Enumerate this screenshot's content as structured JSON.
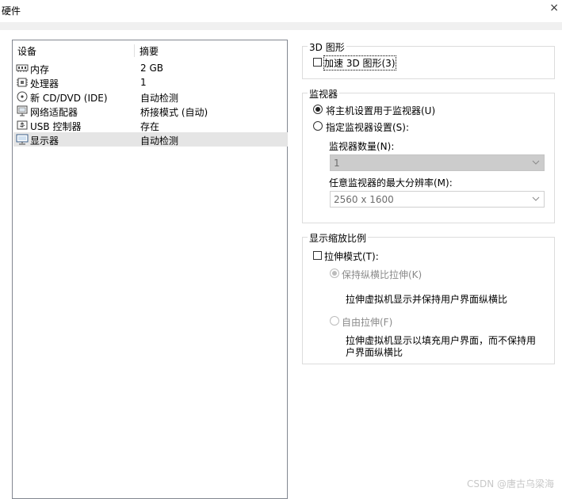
{
  "window": {
    "title": "硬件",
    "close_glyph": "×"
  },
  "device_panel": {
    "header": {
      "device": "设备",
      "summary": "摘要"
    },
    "rows": [
      {
        "icon": "memory-icon",
        "name": "内存",
        "summary": "2 GB"
      },
      {
        "icon": "processor-icon",
        "name": "处理器",
        "summary": "1"
      },
      {
        "icon": "cd-dvd-icon",
        "name": "新 CD/DVD (IDE)",
        "summary": "自动检测"
      },
      {
        "icon": "network-adapter-icon",
        "name": "网络适配器",
        "summary": "桥接模式 (自动)"
      },
      {
        "icon": "usb-icon",
        "name": "USB 控制器",
        "summary": "存在"
      },
      {
        "icon": "display-icon",
        "name": "显示器",
        "summary": "自动检测"
      }
    ],
    "selected_index": 5
  },
  "graphics_3d": {
    "legend": "3D 图形",
    "accelerate_label": "加速 3D 图形(3)",
    "accelerate_checked": false
  },
  "monitors": {
    "legend": "监视器",
    "host_setting_label": "将主机设置用于监视器(U)",
    "host_setting_selected": true,
    "specify_label": "指定监视器设置(S):",
    "specify_selected": false,
    "count_label": "监视器数量(N):",
    "count_value": "1",
    "max_res_label": "任意监视器的最大分辨率(M):",
    "max_res_value": "2560 x 1600"
  },
  "display_scaling": {
    "legend": "显示缩放比例",
    "stretch_label": "拉伸模式(T):",
    "stretch_checked": false,
    "keep_aspect_label": "保持纵横比拉伸(K)",
    "keep_aspect_selected": true,
    "keep_aspect_desc": "拉伸虚拟机显示并保持用户界面纵横比",
    "free_stretch_label": "自由拉伸(F)",
    "free_stretch_selected": false,
    "free_stretch_desc_line1": "拉伸虚拟机显示以填充用户界面，而不保持用",
    "free_stretch_desc_line2": "户界面纵横比"
  },
  "watermark": "CSDN @唐古乌梁海"
}
